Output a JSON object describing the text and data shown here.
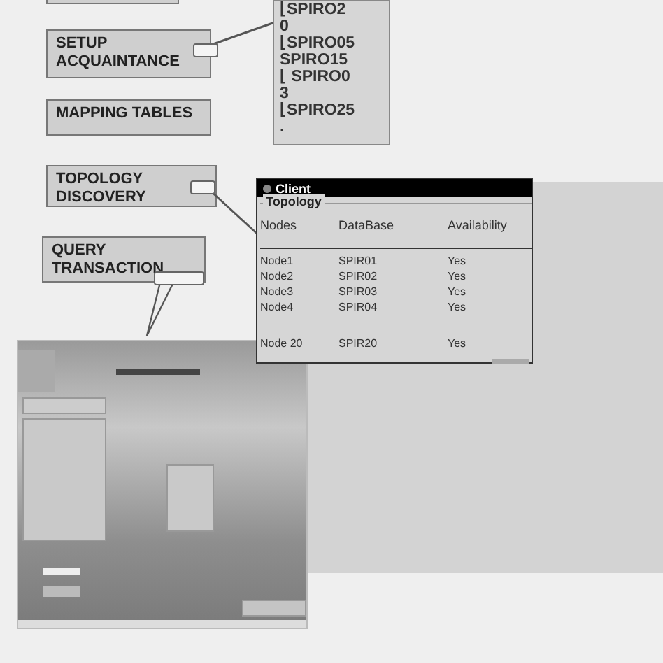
{
  "callouts": [
    {
      "lines": [
        "SETUP",
        "ACQUAINTANCE"
      ]
    },
    {
      "lines": [
        "MAPPING TABLES"
      ]
    },
    {
      "lines": [
        "TOPOLOGY",
        "DISCOVERY"
      ]
    },
    {
      "lines": [
        "QUERY",
        "TRANSACTION"
      ]
    }
  ],
  "tree": [
    "⌊SPIRO2",
    "0",
    "⌊SPIRO05",
    "SPIRO15",
    "⌊ SPIRO0",
    "3",
    "⌊SPIRO25",
    "."
  ],
  "client": {
    "title": "Client",
    "group": "Topology",
    "columns": [
      "Nodes",
      "DataBase",
      "Availability"
    ],
    "rows": [
      [
        "Node1",
        "SPIR01",
        "Yes"
      ],
      [
        "Node2",
        "SPIR02",
        "Yes"
      ],
      [
        "Node3",
        "SPIR03",
        "Yes"
      ],
      [
        "Node4",
        "SPIR04",
        "Yes"
      ],
      [
        "Node 20",
        "SPIR20",
        "Yes"
      ]
    ]
  }
}
